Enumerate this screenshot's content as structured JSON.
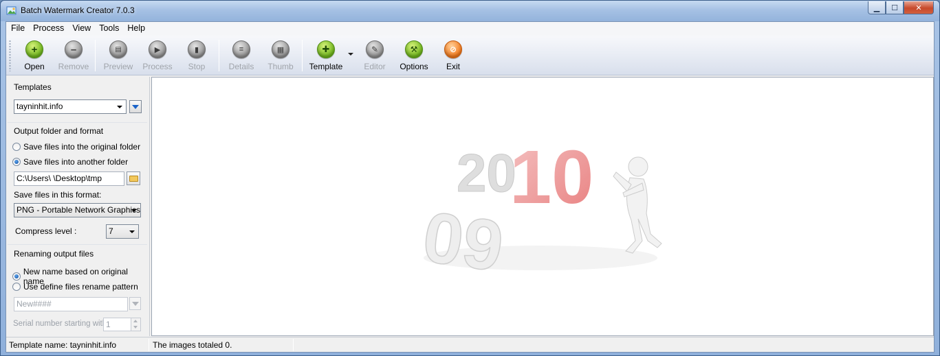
{
  "window": {
    "title": "Batch Watermark Creator 7.0.3"
  },
  "menu": [
    "File",
    "Process",
    "View",
    "Tools",
    "Help"
  ],
  "toolbar": {
    "open": "Open",
    "remove": "Remove",
    "preview": "Preview",
    "process": "Process",
    "stop": "Stop",
    "details": "Details",
    "thumb": "Thumb",
    "template": "Template",
    "editor": "Editor",
    "options": "Options",
    "exit": "Exit"
  },
  "templates": {
    "title": "Templates",
    "selected": "tayninhit.info"
  },
  "output": {
    "title": "Output folder and format",
    "option_original": "Save files into the original folder",
    "option_another": "Save files into another folder",
    "folder_path": "C:\\Users\\             \\Desktop\\tmp",
    "format_label": "Save files in this format:",
    "format_selected": "PNG - Portable Network Graphics",
    "compress_label": "Compress level :",
    "compress_value": "7"
  },
  "renaming": {
    "title": "Renaming output files",
    "option_original": "New name based on original name",
    "option_pattern": "Use define files rename pattern",
    "pattern_value": "New####",
    "serial_label": "Serial number starting with",
    "serial_value": "1"
  },
  "preview_art": {
    "digits_back": "20",
    "digits_front": "09",
    "digits_red": "10"
  },
  "status": {
    "template_name": "Template name: tayninhit.info",
    "images_total": "The images totaled 0."
  },
  "colors": {
    "accent_red": "#e84c4c",
    "toolbar_green": "#6fb51c",
    "exit_orange": "#f47a1c"
  }
}
